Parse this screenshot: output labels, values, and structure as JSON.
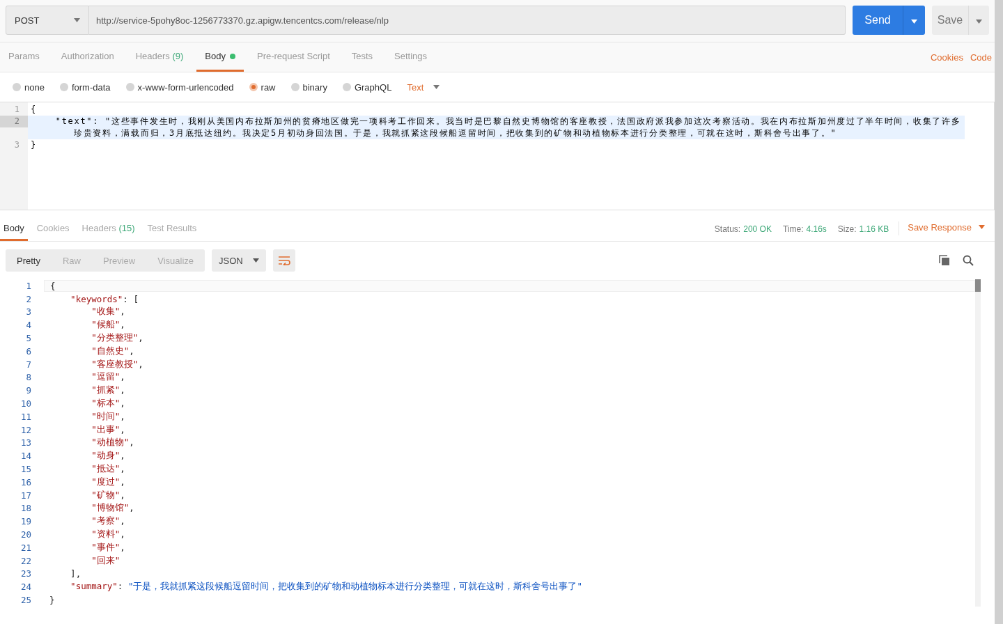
{
  "request": {
    "method": "POST",
    "url": "http://service-5pohy8oc-1256773370.gz.apigw.tencentcs.com/release/nlp",
    "send": "Send",
    "save": "Save"
  },
  "request_tabs": [
    {
      "label": "Params",
      "selected": false
    },
    {
      "label": "Authorization",
      "selected": false
    },
    {
      "label": "Headers",
      "count": "(9)",
      "selected": false
    },
    {
      "label": "Body",
      "selected": true,
      "dot": true
    },
    {
      "label": "Pre-request Script",
      "selected": false
    },
    {
      "label": "Tests",
      "selected": false
    },
    {
      "label": "Settings",
      "selected": false
    }
  ],
  "request_links": [
    "Cookies",
    "Code"
  ],
  "body_types": [
    {
      "label": "none",
      "selected": false
    },
    {
      "label": "form-data",
      "selected": false
    },
    {
      "label": "x-www-form-urlencoded",
      "selected": false
    },
    {
      "label": "raw",
      "selected": true
    },
    {
      "label": "binary",
      "selected": false
    },
    {
      "label": "GraphQL",
      "selected": false
    }
  ],
  "raw_format": "Text",
  "request_body": [
    {
      "number": "1",
      "text": "{",
      "current": false
    },
    {
      "number": "2",
      "text": "    \"text\": \"这些事件发生时，我刚从美国内布拉斯加州的贫瘠地区做完一项科考工作回来。我当时是巴黎自然史博物馆的客座教授，法国政府派我参加这次考察活动。我在内布拉斯加州度过了半年时间，收集了许多珍贵资料，满载而归，3月底抵达纽约。我决定5月初动身回法国。于是，我就抓紧这段候船逗留时间，把收集到的矿物和动植物标本进行分类整理，可就在这时，斯科舍号出事了。\"",
      "current": true
    },
    {
      "number": "3",
      "text": "}",
      "current": false
    }
  ],
  "response_tabs": [
    {
      "label": "Body",
      "selected": true
    },
    {
      "label": "Cookies",
      "selected": false
    },
    {
      "label": "Headers",
      "count": "(15)",
      "selected": false
    },
    {
      "label": "Test Results",
      "selected": false
    }
  ],
  "status": [
    {
      "label": "Status:",
      "value": "200 OK"
    },
    {
      "label": "Time:",
      "value": "4.16s"
    },
    {
      "label": "Size:",
      "value": "1.16 KB"
    }
  ],
  "save_response": "Save Response",
  "view_modes": [
    {
      "label": "Pretty",
      "selected": true
    },
    {
      "label": "Raw",
      "selected": false
    },
    {
      "label": "Preview",
      "selected": false
    },
    {
      "label": "Visualize",
      "selected": false
    }
  ],
  "response_format": "JSON",
  "response_body": [
    {
      "number": "1",
      "tokens": [
        {
          "kind": "punct",
          "text": "{"
        }
      ]
    },
    {
      "number": "2",
      "tokens": [
        {
          "kind": "key",
          "text": "    \"keywords\""
        },
        {
          "kind": "punct",
          "text": ": ["
        }
      ]
    },
    {
      "number": "3",
      "tokens": [
        {
          "kind": "string",
          "text": "        \"收集\""
        },
        {
          "kind": "punct",
          "text": ","
        }
      ]
    },
    {
      "number": "4",
      "tokens": [
        {
          "kind": "string",
          "text": "        \"候船\""
        },
        {
          "kind": "punct",
          "text": ","
        }
      ]
    },
    {
      "number": "5",
      "tokens": [
        {
          "kind": "string",
          "text": "        \"分类整理\""
        },
        {
          "kind": "punct",
          "text": ","
        }
      ]
    },
    {
      "number": "6",
      "tokens": [
        {
          "kind": "string",
          "text": "        \"自然史\""
        },
        {
          "kind": "punct",
          "text": ","
        }
      ]
    },
    {
      "number": "7",
      "tokens": [
        {
          "kind": "string",
          "text": "        \"客座教授\""
        },
        {
          "kind": "punct",
          "text": ","
        }
      ]
    },
    {
      "number": "8",
      "tokens": [
        {
          "kind": "string",
          "text": "        \"逗留\""
        },
        {
          "kind": "punct",
          "text": ","
        }
      ]
    },
    {
      "number": "9",
      "tokens": [
        {
          "kind": "string",
          "text": "        \"抓紧\""
        },
        {
          "kind": "punct",
          "text": ","
        }
      ]
    },
    {
      "number": "10",
      "tokens": [
        {
          "kind": "string",
          "text": "        \"标本\""
        },
        {
          "kind": "punct",
          "text": ","
        }
      ]
    },
    {
      "number": "11",
      "tokens": [
        {
          "kind": "string",
          "text": "        \"时间\""
        },
        {
          "kind": "punct",
          "text": ","
        }
      ]
    },
    {
      "number": "12",
      "tokens": [
        {
          "kind": "string",
          "text": "        \"出事\""
        },
        {
          "kind": "punct",
          "text": ","
        }
      ]
    },
    {
      "number": "13",
      "tokens": [
        {
          "kind": "string",
          "text": "        \"动植物\""
        },
        {
          "kind": "punct",
          "text": ","
        }
      ]
    },
    {
      "number": "14",
      "tokens": [
        {
          "kind": "string",
          "text": "        \"动身\""
        },
        {
          "kind": "punct",
          "text": ","
        }
      ]
    },
    {
      "number": "15",
      "tokens": [
        {
          "kind": "string",
          "text": "        \"抵达\""
        },
        {
          "kind": "punct",
          "text": ","
        }
      ]
    },
    {
      "number": "16",
      "tokens": [
        {
          "kind": "string",
          "text": "        \"度过\""
        },
        {
          "kind": "punct",
          "text": ","
        }
      ]
    },
    {
      "number": "17",
      "tokens": [
        {
          "kind": "string",
          "text": "        \"矿物\""
        },
        {
          "kind": "punct",
          "text": ","
        }
      ]
    },
    {
      "number": "18",
      "tokens": [
        {
          "kind": "string",
          "text": "        \"博物馆\""
        },
        {
          "kind": "punct",
          "text": ","
        }
      ]
    },
    {
      "number": "19",
      "tokens": [
        {
          "kind": "string",
          "text": "        \"考察\""
        },
        {
          "kind": "punct",
          "text": ","
        }
      ]
    },
    {
      "number": "20",
      "tokens": [
        {
          "kind": "string",
          "text": "        \"资料\""
        },
        {
          "kind": "punct",
          "text": ","
        }
      ]
    },
    {
      "number": "21",
      "tokens": [
        {
          "kind": "string",
          "text": "        \"事件\""
        },
        {
          "kind": "punct",
          "text": ","
        }
      ]
    },
    {
      "number": "22",
      "tokens": [
        {
          "kind": "string",
          "text": "        \"回来\""
        }
      ]
    },
    {
      "number": "23",
      "tokens": [
        {
          "kind": "punct",
          "text": "    ],"
        }
      ]
    },
    {
      "number": "24",
      "tokens": [
        {
          "kind": "key",
          "text": "    \"summary\""
        },
        {
          "kind": "punct",
          "text": ": "
        },
        {
          "kind": "value",
          "text": "\"于是，我就抓紧这段候船逗留时间，把收集到的矿物和动植物标本进行分类整理，可就在这时，斯科舍号出事了\""
        }
      ]
    },
    {
      "number": "25",
      "tokens": [
        {
          "kind": "punct",
          "text": "}"
        }
      ]
    }
  ]
}
